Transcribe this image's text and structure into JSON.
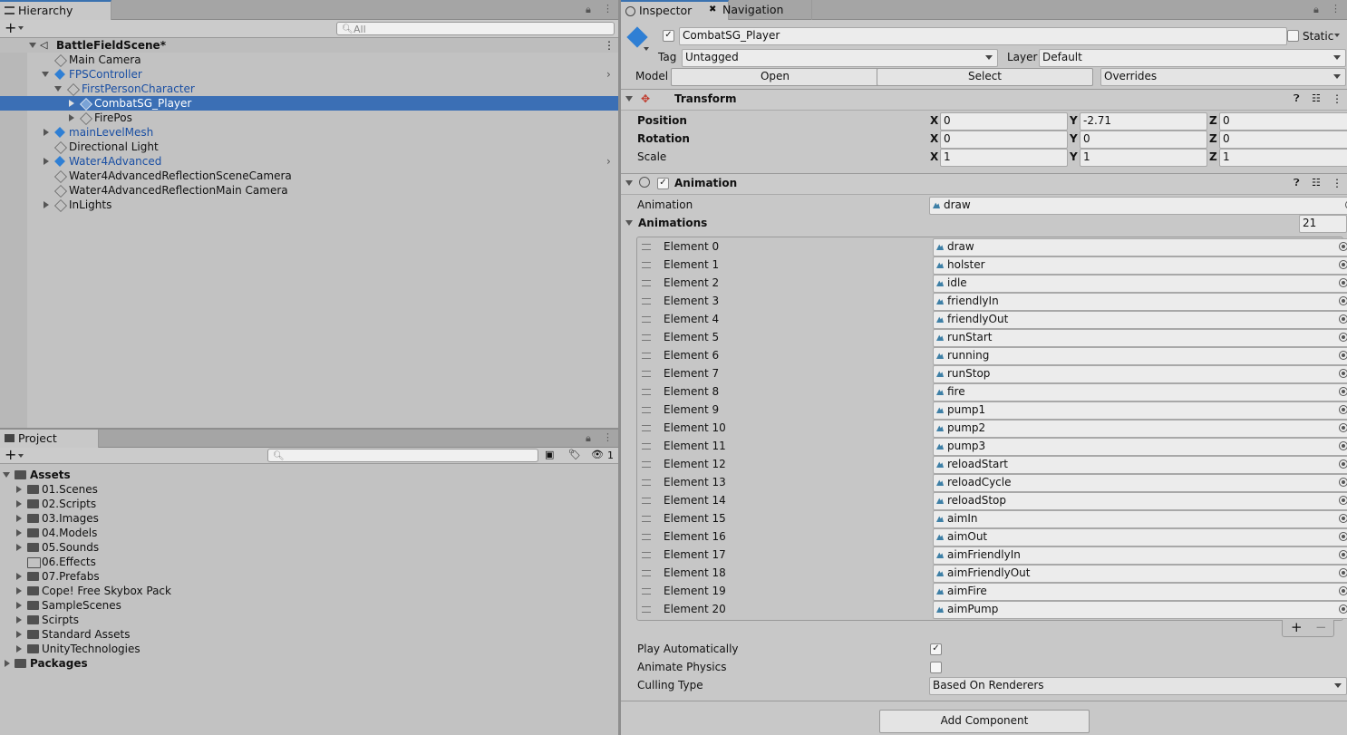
{
  "hierarchy": {
    "tab": "Hierarchy",
    "search_placeholder": "All",
    "scene": "BattleFieldScene*",
    "items": [
      {
        "label": "Main Camera"
      },
      {
        "label": "FPSController"
      },
      {
        "label": "FirstPersonCharacter"
      },
      {
        "label": "CombatSG_Player"
      },
      {
        "label": "FirePos"
      },
      {
        "label": "mainLevelMesh"
      },
      {
        "label": "Directional Light"
      },
      {
        "label": "Water4Advanced"
      },
      {
        "label": "Water4AdvancedReflectionSceneCamera"
      },
      {
        "label": "Water4AdvancedReflectionMain Camera"
      },
      {
        "label": "InLights"
      }
    ]
  },
  "project": {
    "tab": "Project",
    "hidden_count": "1",
    "root": "Assets",
    "folders": [
      "01.Scenes",
      "02.Scripts",
      "03.Images",
      "04.Models",
      "05.Sounds",
      "06.Effects",
      "07.Prefabs",
      "Cope! Free Skybox Pack",
      "SampleScenes",
      "Scirpts",
      "Standard Assets",
      "UnityTechnologies"
    ],
    "packages": "Packages"
  },
  "inspector": {
    "tab_inspector": "Inspector",
    "tab_navigation": "Navigation",
    "object_name": "CombatSG_Player",
    "static_label": "Static",
    "tag_label": "Tag",
    "tag_value": "Untagged",
    "layer_label": "Layer",
    "layer_value": "Default",
    "model_label": "Model",
    "open_btn": "Open",
    "select_btn": "Select",
    "overrides": "Overrides",
    "transform": {
      "title": "Transform",
      "position_label": "Position",
      "rotation_label": "Rotation",
      "scale_label": "Scale",
      "x": "X",
      "y": "Y",
      "z": "Z",
      "position": [
        "0",
        "-2.71",
        "0"
      ],
      "rotation": [
        "0",
        "0",
        "0"
      ],
      "scale": [
        "1",
        "1",
        "1"
      ]
    },
    "animation": {
      "title": "Animation",
      "animation_label": "Animation",
      "animation_value": "draw",
      "animations_label": "Animations",
      "count": "21",
      "elements": [
        {
          "label": "Element 0",
          "value": "draw"
        },
        {
          "label": "Element 1",
          "value": "holster"
        },
        {
          "label": "Element 2",
          "value": "idle"
        },
        {
          "label": "Element 3",
          "value": "friendlyIn"
        },
        {
          "label": "Element 4",
          "value": "friendlyOut"
        },
        {
          "label": "Element 5",
          "value": "runStart"
        },
        {
          "label": "Element 6",
          "value": "running"
        },
        {
          "label": "Element 7",
          "value": "runStop"
        },
        {
          "label": "Element 8",
          "value": "fire"
        },
        {
          "label": "Element 9",
          "value": "pump1"
        },
        {
          "label": "Element 10",
          "value": "pump2"
        },
        {
          "label": "Element 11",
          "value": "pump3"
        },
        {
          "label": "Element 12",
          "value": "reloadStart"
        },
        {
          "label": "Element 13",
          "value": "reloadCycle"
        },
        {
          "label": "Element 14",
          "value": "reloadStop"
        },
        {
          "label": "Element 15",
          "value": "aimIn"
        },
        {
          "label": "Element 16",
          "value": "aimOut"
        },
        {
          "label": "Element 17",
          "value": "aimFriendlyIn"
        },
        {
          "label": "Element 18",
          "value": "aimFriendlyOut"
        },
        {
          "label": "Element 19",
          "value": "aimFire"
        },
        {
          "label": "Element 20",
          "value": "aimPump"
        }
      ],
      "add": "+",
      "remove": "−",
      "play_auto_label": "Play Automatically",
      "play_auto": true,
      "animate_physics_label": "Animate Physics",
      "animate_physics": false,
      "culling_label": "Culling Type",
      "culling_value": "Based On Renderers"
    },
    "add_component": "Add Component"
  }
}
